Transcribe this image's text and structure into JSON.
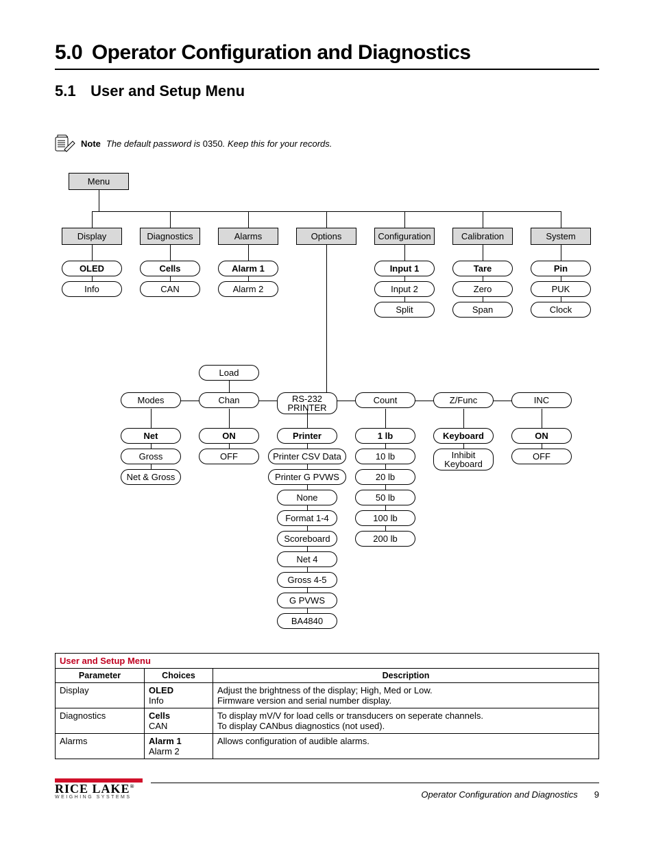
{
  "h1": {
    "num": "5.0",
    "title": "Operator Configuration and Diagnostics"
  },
  "h2": {
    "num": "5.1",
    "title": "User and Setup Menu"
  },
  "note": {
    "label": "Note",
    "text_prefix": "The default password is ",
    "password": "0350",
    "text_suffix": ". Keep this for your records."
  },
  "tree": {
    "root": "Menu",
    "row1": [
      "Display",
      "Diagnostics",
      "Alarms",
      "Options",
      "Configuration",
      "Calibration",
      "System"
    ],
    "col_display": [
      "OLED",
      "Info"
    ],
    "col_diagnostics": [
      "Cells",
      "CAN"
    ],
    "col_alarms": [
      "Alarm 1",
      "Alarm 2"
    ],
    "col_config": [
      "Input 1",
      "Input 2",
      "Split"
    ],
    "col_calib": [
      "Tare",
      "Zero",
      "Span"
    ],
    "col_system": [
      "Pin",
      "PUK",
      "Clock"
    ],
    "options_row_upper": [
      "Load"
    ],
    "options_row": [
      "Modes",
      "Chan",
      "RS-232 PRINTER",
      "Count",
      "Z/Func",
      "INC"
    ],
    "opt_modes": [
      "Net",
      "Gross",
      "Net & Gross"
    ],
    "opt_chan": [
      "ON",
      "OFF"
    ],
    "opt_prn": [
      "Printer",
      "Printer CSV Data",
      "Printer G PVWS",
      "None",
      "Format 1-4",
      "Scoreboard",
      "Net 4",
      "Gross 4-5",
      "G PVWS",
      "BA4840"
    ],
    "opt_count": [
      "1 lb",
      "10 lb",
      "20 lb",
      "50 lb",
      "100 lb",
      "200 lb"
    ],
    "opt_zfunc": [
      "Keyboard",
      "Inhibit Keyboard"
    ],
    "opt_inc": [
      "ON",
      "OFF"
    ]
  },
  "table": {
    "title": "User and Setup Menu",
    "headers": [
      "Parameter",
      "Choices",
      "Description"
    ],
    "rows": [
      {
        "param": "Display",
        "choices": [
          "OLED",
          "Info"
        ],
        "desc": [
          "Adjust the brightness of the display; High, Med or Low.",
          "Firmware version and serial number display."
        ]
      },
      {
        "param": "Diagnostics",
        "choices": [
          "Cells",
          "CAN"
        ],
        "desc": [
          "To display mV/V for load cells or transducers on seperate channels.",
          "To display CANbus diagnostics (not used)."
        ]
      },
      {
        "param": "Alarms",
        "choices": [
          "Alarm 1",
          "Alarm 2"
        ],
        "desc": [
          "Allows configuration of audible alarms.",
          ""
        ]
      }
    ]
  },
  "footer": {
    "brand": "RICE LAKE",
    "sub": "WEIGHING SYSTEMS",
    "section": "Operator Configuration and Diagnostics",
    "page": "9"
  },
  "chart_data": {
    "type": "tree",
    "title": "User and Setup Menu hierarchy",
    "root": "Menu",
    "children": [
      {
        "name": "Display",
        "children": [
          "OLED",
          "Info"
        ]
      },
      {
        "name": "Diagnostics",
        "children": [
          "Cells",
          "CAN"
        ]
      },
      {
        "name": "Alarms",
        "children": [
          "Alarm 1",
          "Alarm 2"
        ]
      },
      {
        "name": "Options",
        "children": [
          {
            "name": "Modes",
            "children": [
              "Net",
              "Gross",
              "Net & Gross"
            ]
          },
          {
            "name": "Chan",
            "upper": "Load",
            "children": [
              "ON",
              "OFF"
            ]
          },
          {
            "name": "RS-232 PRINTER",
            "children": [
              "Printer",
              "Printer CSV Data",
              "Printer G PVWS",
              "None",
              "Format 1-4",
              "Scoreboard",
              "Net 4",
              "Gross 4-5",
              "G PVWS",
              "BA4840"
            ]
          },
          {
            "name": "Count",
            "children": [
              "1 lb",
              "10 lb",
              "20 lb",
              "50 lb",
              "100 lb",
              "200 lb"
            ]
          },
          {
            "name": "Z/Func",
            "children": [
              "Keyboard",
              "Inhibit Keyboard"
            ]
          },
          {
            "name": "INC",
            "children": [
              "ON",
              "OFF"
            ]
          }
        ]
      },
      {
        "name": "Configuration",
        "children": [
          "Input 1",
          "Input 2",
          "Split"
        ]
      },
      {
        "name": "Calibration",
        "children": [
          "Tare",
          "Zero",
          "Span"
        ]
      },
      {
        "name": "System",
        "children": [
          "Pin",
          "PUK",
          "Clock"
        ]
      }
    ]
  }
}
